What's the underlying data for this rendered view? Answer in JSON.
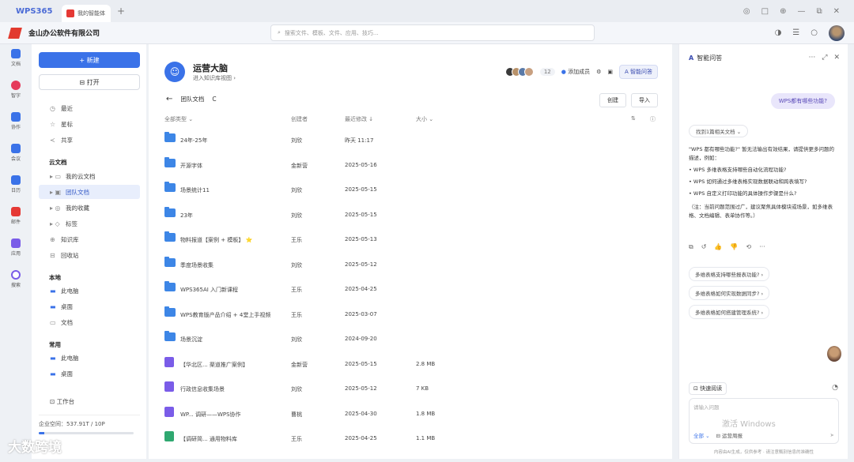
{
  "titlebar": {
    "app_logo": "WPS365",
    "tab_label": "我的智能体",
    "new_tab": "+",
    "window_controls": [
      "◎",
      "□",
      "⊕",
      "—",
      "⧉",
      "✕"
    ]
  },
  "appbar": {
    "company": "金山办公软件有限公司",
    "search_placeholder": "搜索文件、模板、文件、应用、技巧...",
    "icons": [
      "◑",
      "☰",
      "○"
    ]
  },
  "rail": {
    "items": [
      {
        "label": "文档",
        "color": "#3a72e8"
      },
      {
        "label": "智字",
        "color": "#e53a5a"
      },
      {
        "label": "协作",
        "color": "#3a72e8"
      },
      {
        "label": "会议",
        "color": "#3a72e8"
      },
      {
        "label": "日历",
        "color": "#3a72e8"
      },
      {
        "label": "邮件",
        "color": "#e53935"
      },
      {
        "label": "应用",
        "color": "#7a5ce8"
      },
      {
        "label": "搜索",
        "color": "#7a5ce8"
      }
    ]
  },
  "sidebar": {
    "new_label": "+ 新建",
    "open_label": "⊟ 打开",
    "nav": [
      {
        "icon": "◷",
        "label": "最近"
      },
      {
        "icon": "☆",
        "label": "星标"
      },
      {
        "icon": "≺",
        "label": "共享"
      }
    ],
    "cloud_header": "云文档",
    "cloud": [
      {
        "icon": "▸ ▭",
        "label": "我的云文档"
      },
      {
        "icon": "▸ ▣",
        "label": "团队文档"
      },
      {
        "icon": "▸ ◎",
        "label": "我的收藏"
      },
      {
        "icon": "▸ ◇",
        "label": "标签"
      },
      {
        "icon": "⊕",
        "label": "知识库"
      },
      {
        "icon": "⊟",
        "label": "回收站"
      }
    ],
    "local_header": "本地",
    "local": [
      {
        "label": "此电脑"
      },
      {
        "label": "桌面"
      },
      {
        "label": "文档"
      }
    ],
    "common_header": "常用",
    "common": [
      {
        "label": "此电脑"
      },
      {
        "label": "桌面"
      }
    ],
    "workbench": "⊡ 工作台",
    "storage_label": "企业空间：537.91T / 10P",
    "storage_fraction": 0.06
  },
  "main": {
    "kb_title": "运营大脑",
    "kb_sub": "进入知识库视图 ›",
    "member_count": "12",
    "add_member": "添加成员",
    "smart_qa": "A 智能问答",
    "back": "←",
    "path_label": "团队文档",
    "refresh": "C",
    "btn_create": "创建",
    "btn_import": "导入",
    "header": {
      "name": "全部类型 ⌄",
      "owner": "创建者",
      "modified": "最近修改 ↓",
      "size": "大小 ⌄"
    },
    "rows": [
      {
        "type": "folder",
        "name": "24年-25年",
        "owner": "刘欣",
        "date": "昨天 11:17",
        "size": ""
      },
      {
        "type": "folder",
        "name": "开源字体",
        "owner": "金新营",
        "date": "2025-05-16",
        "size": ""
      },
      {
        "type": "folder",
        "name": "场景统计11",
        "owner": "刘欣",
        "date": "2025-05-15",
        "size": ""
      },
      {
        "type": "folder",
        "name": "23年",
        "owner": "刘欣",
        "date": "2025-05-15",
        "size": ""
      },
      {
        "type": "folder",
        "name": "物料报道【案例 + 模板】 ⭐",
        "owner": "王乐",
        "date": "2025-05-13",
        "size": ""
      },
      {
        "type": "folder",
        "name": "季度场景收集",
        "owner": "刘欣",
        "date": "2025-05-12",
        "size": ""
      },
      {
        "type": "folder",
        "name": "WPS365AI 入门新课程",
        "owner": "王乐",
        "date": "2025-04-25",
        "size": ""
      },
      {
        "type": "folder",
        "name": "WPS教育版产品介绍 + 4堂上手视频",
        "owner": "王乐",
        "date": "2025-03-07",
        "size": ""
      },
      {
        "type": "folder",
        "name": "场景沉淀",
        "owner": "刘欣",
        "date": "2024-09-20",
        "size": ""
      },
      {
        "type": "file",
        "color": "#7a5ce8",
        "name": "【华北区... 渠道推广案例】",
        "owner": "金新营",
        "date": "2025-05-15",
        "size": "2.8 MB"
      },
      {
        "type": "file",
        "color": "#7a5ce8",
        "name": "行政信息收集场景",
        "owner": "刘欣",
        "date": "2025-05-12",
        "size": "7 KB"
      },
      {
        "type": "file",
        "color": "#7a5ce8",
        "name": "WP... 调研——WPS协作",
        "owner": "曹桃",
        "date": "2025-04-30",
        "size": "1.8 MB"
      },
      {
        "type": "file",
        "color": "#2fa870",
        "name": "【调研简... 通用物料库",
        "owner": "王乐",
        "date": "2025-04-25",
        "size": "1.1 MB"
      }
    ]
  },
  "assistant": {
    "title": "智能问答",
    "controls": [
      "···",
      "⤢",
      "✕"
    ],
    "question": "WPS都有哪些功能?",
    "source_select": "找到1篇相关文档 ⌄",
    "answer_intro": "\"WPS 都有哪些功能?\" 暂无法输出有效结果，请提供更多问题的描述，例如：",
    "answer_items": [
      "WPS 多维表格支持哪些自动化流程功能?",
      "WPS 如何通过多维表格实现数据联动和跨表填写?",
      "WPS 自定义打印功能的具体操作步骤是什么?"
    ],
    "answer_note": "（注：当前问题范围过广，建议聚焦具体模块或场景，如多维表格、文档编辑、表单协作等。）",
    "actions": [
      "⧉",
      "↺",
      "👍",
      "👎",
      "⟲",
      "···"
    ],
    "suggestions": [
      "多维表格支持哪些报表功能? ›",
      "多维表格如何实现数据同步? ›",
      "多维表格如何搭建管理系统? ›"
    ],
    "quick_read": "⊡ 快速阅读",
    "input_placeholder": "请输入问题",
    "input_scope": "全部 ⌄",
    "input_tag": "⊟ 运营周报",
    "send": "➤",
    "disclaimer": "内容由AI生成，仅供参考  · 请注意甄别信息的准确性",
    "activate": "激活 Windows"
  },
  "watermark": "大数跨境"
}
